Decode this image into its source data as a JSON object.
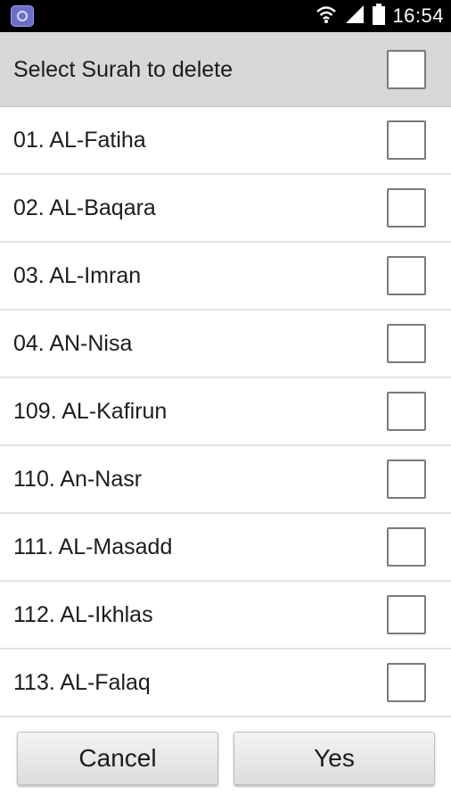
{
  "status_bar": {
    "time": "16:54",
    "app_icon": "app-icon",
    "icons": [
      "wifi-icon",
      "signal-icon",
      "battery-icon"
    ]
  },
  "header": {
    "title": "Select Surah to delete",
    "select_all_checked": false
  },
  "surahs": [
    {
      "label": "01. AL-Fatiha",
      "checked": false
    },
    {
      "label": "02. AL-Baqara",
      "checked": false
    },
    {
      "label": "03. AL-Imran",
      "checked": false
    },
    {
      "label": "04. AN-Nisa",
      "checked": false
    },
    {
      "label": "109. AL-Kafirun",
      "checked": false
    },
    {
      "label": "110. An-Nasr",
      "checked": false
    },
    {
      "label": "111. AL-Masadd",
      "checked": false
    },
    {
      "label": "112. AL-Ikhlas",
      "checked": false
    },
    {
      "label": "113. AL-Falaq",
      "checked": false
    }
  ],
  "buttons": {
    "cancel": "Cancel",
    "yes": "Yes"
  }
}
